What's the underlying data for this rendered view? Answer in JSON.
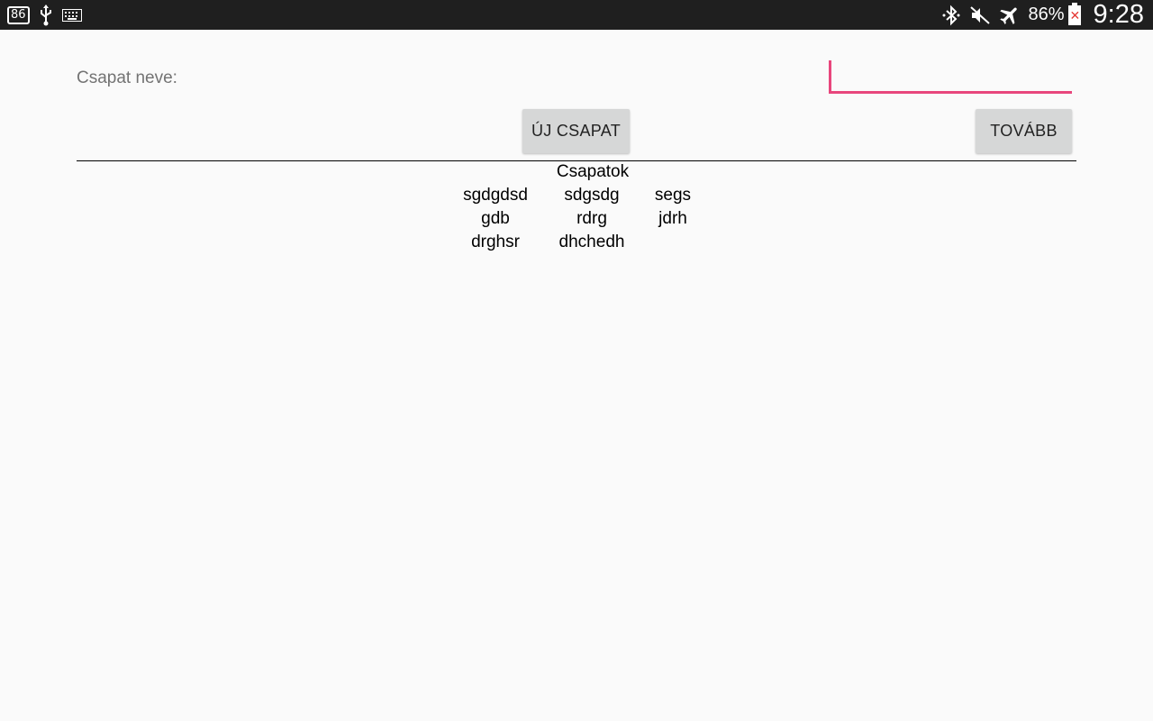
{
  "status_bar": {
    "left_badge": "86",
    "battery_percent": "86%",
    "time": "9:28",
    "icons": [
      "86-badge-icon",
      "usb-icon",
      "keyboard-icon",
      "bluetooth-icon",
      "mute-icon",
      "airplane-mode-icon",
      "battery-icon"
    ]
  },
  "form": {
    "name_label": "Csapat neve:",
    "name_value": "",
    "name_placeholder": ""
  },
  "buttons": {
    "new_team": "ÚJ CSAPAT",
    "next": "TOVÁBB"
  },
  "teams": {
    "title": "Csapatok",
    "rows": [
      [
        "sgdgdsd",
        "sdgsdg",
        "segs"
      ],
      [
        "gdb",
        "rdrg",
        "jdrh"
      ],
      [
        "drghsr",
        "dhchedh",
        ""
      ]
    ]
  },
  "colors": {
    "accent": "#e8467c",
    "status_bar": "#1f1f1f",
    "background": "#fafafa",
    "button": "#d6d7d7"
  }
}
